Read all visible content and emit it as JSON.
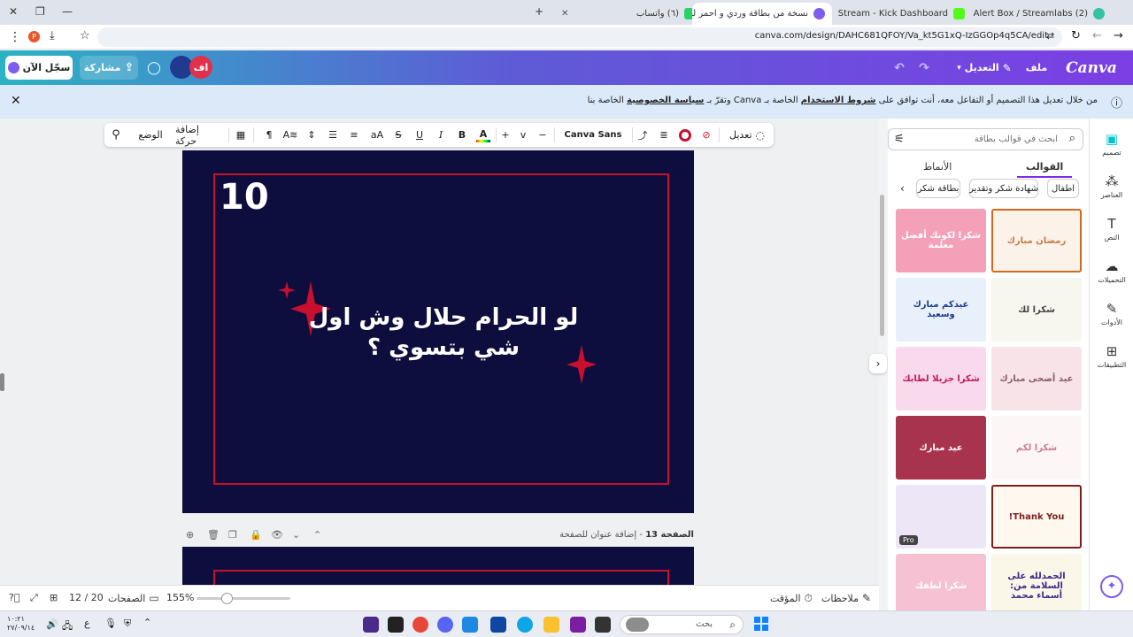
{
  "browser": {
    "tabs": [
      {
        "title": "نسخة من بطاقة وردي و احمر لط...",
        "active": true,
        "color": "#7d5cf0"
      },
      {
        "title": "Stream - Kick Dashboard",
        "active": false,
        "color": "#53fc18"
      },
      {
        "title": "(2) Alert Box / Streamlabs",
        "active": false,
        "color": "#31c3a2"
      },
      {
        "title": "(٦) واتساب",
        "active": false,
        "color": "#25d366"
      }
    ],
    "url": "canva.com/design/DAHC681QFOY/Va_kt5G1xQ-IzGGOp4q5CA/edit",
    "profile_badge": "P"
  },
  "header": {
    "logo": "Canva",
    "file_menu": "ملف",
    "edit_menu": "التعديل",
    "share": "مشاركة",
    "signup": "سجّل الآن",
    "avatar_initials": "اف"
  },
  "notice": {
    "prefix": "من خلال تعديل هذا التصميم أو التفاعل معه، أنت توافق على",
    "terms": "شروط الاستخدام",
    "middle": "الخاصة بـ Canva وتقرّ بـ",
    "privacy": "سياسة الخصوصية",
    "suffix": "الخاصة بنا"
  },
  "toolbar": {
    "edit": "تعديل",
    "font": "Canva Sans",
    "minus": "−",
    "size": "v",
    "plus": "+",
    "bold": "B",
    "italic": "I",
    "underline": "U",
    "strike": "S",
    "case": "aA",
    "animate": "إضافة حركة",
    "position": "الوضع"
  },
  "slide": {
    "number": "10",
    "text": "لو الحرام حلال وش اول شي بتسوي ؟",
    "bg_color": "#0d0e3d",
    "accent_color": "#c8102e"
  },
  "page_info": {
    "label": "الصفحة 13",
    "title_placeholder": "- إضافة عنوان للصفحة"
  },
  "statusbar": {
    "notes": "ملاحظات",
    "timer": "المؤقت",
    "zoom": "155%",
    "pages": "الصفحات",
    "page_count": "20 / 12"
  },
  "panel": {
    "search_placeholder": "ابحث في قوالب بطاقة",
    "tab_templates": "القوالب",
    "tab_styles": "الأنماط",
    "chips": [
      "اطفال",
      "شهادة شكر وتقدير",
      "بطاقة شكر"
    ],
    "thumbs": [
      {
        "text": "رمضان مبارك",
        "bg": "#fbf3e9",
        "fg": "#c9794b",
        "border": "#d2691e"
      },
      {
        "text": "شكرا لكونك أفضل معلمة",
        "bg": "#f4a0b8",
        "fg": "#ffffff",
        "border": ""
      },
      {
        "text": "شكرا لك",
        "bg": "#f7f6ef",
        "fg": "#444444",
        "border": ""
      },
      {
        "text": "عيدكم مبارك وسعيد",
        "bg": "#e8f0fb",
        "fg": "#1b3c8c",
        "border": ""
      },
      {
        "text": "عيد أضحى مبارك",
        "bg": "#f7e3e8",
        "fg": "#8a5c6b",
        "border": ""
      },
      {
        "text": "شكرا جزيلا لطابك",
        "bg": "#f9d9ec",
        "fg": "#c2185b",
        "border": ""
      },
      {
        "text": "شكرا لكم",
        "bg": "#fdf6f7",
        "fg": "#c77d96",
        "border": ""
      },
      {
        "text": "عيد مبارك",
        "bg": "#a8334f",
        "fg": "#ffffff",
        "border": ""
      },
      {
        "text": "Thank You!",
        "bg": "#fff8ef",
        "fg": "#7a1e1e",
        "border": "#7a1e1e"
      },
      {
        "text": "",
        "bg": "#ece6f7",
        "fg": "#6b6b6b",
        "border": "",
        "pro": "Pro"
      },
      {
        "text": "الحمدلله على السلامة من: أسماء محمد",
        "bg": "#fbf7e8",
        "fg": "#3b2a8a",
        "border": ""
      },
      {
        "text": "شكرا لطفك",
        "bg": "#f6c1d3",
        "fg": "#ffffff",
        "border": ""
      }
    ]
  },
  "sidebar": {
    "items": [
      "تصميم",
      "العناصر",
      "النص",
      "التحميلات",
      "الأدوات",
      "التطبيقات"
    ]
  },
  "taskbar": {
    "search": "بحث",
    "lang": "ع",
    "time": "١٠:٢١",
    "date": "٢٧/٠٩/١٤"
  }
}
